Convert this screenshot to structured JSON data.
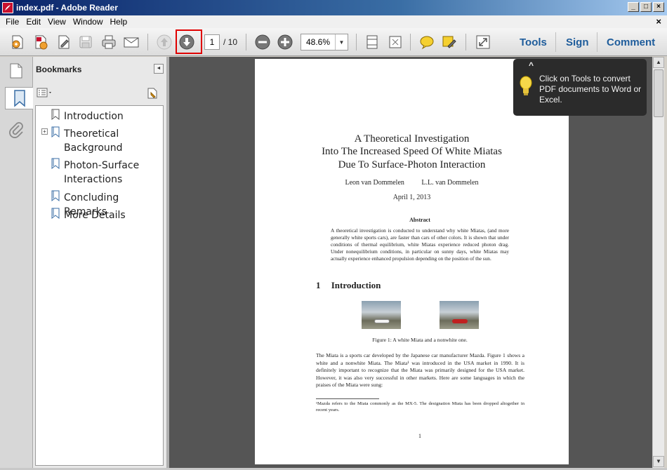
{
  "window": {
    "title": "index.pdf - Adobe Reader",
    "controls": [
      "_",
      "□",
      "×"
    ]
  },
  "menubar": {
    "items": [
      "File",
      "Edit",
      "View",
      "Window",
      "Help"
    ],
    "close": "×"
  },
  "toolbar": {
    "icons": [
      "create-pdf-icon",
      "export-pdf-icon",
      "edit-icon",
      "save-icon",
      "print-icon",
      "email-icon",
      "previous-page-icon",
      "next-page-icon",
      "zoom-out-icon",
      "zoom-in-icon",
      "fit-page-icon",
      "full-screen-icon",
      "comment-icon",
      "sign-icon",
      "read-mode-icon"
    ],
    "page_current": "1",
    "page_total": "/ 10",
    "zoom": "48.6%",
    "tools_label": "Tools",
    "sign_label": "Sign",
    "comment_label": "Comment"
  },
  "bookmarks": {
    "title": "Bookmarks",
    "items": [
      {
        "label": "Introduction"
      },
      {
        "label": "Theoretical\nBackground",
        "line1": "Theoretical",
        "line2": "Background",
        "expandable": true
      },
      {
        "label": "Photon-Surface\nInteractions",
        "line1": "Photon-Surface",
        "line2": "Interactions"
      },
      {
        "label": "Concluding Remarks"
      },
      {
        "label": "More Details"
      }
    ]
  },
  "tooltip": {
    "text": "Click on Tools to convert PDF documents to Word or Excel."
  },
  "document": {
    "title_lines": [
      "A Theoretical Investigation",
      "Into The Increased Speed Of White Miatas",
      "Due To Surface-Photon Interaction"
    ],
    "authors": [
      "Leon van Dommelen",
      "L.L. van Dommelen"
    ],
    "date": "April 1, 2013",
    "abstract_heading": "Abstract",
    "abstract": "A theoretical investigation is conducted to understand why white Miatas, (and more generally white sports cars), are faster than cars of other colors. It is shown that under conditions of thermal equilibrium, white Miatas experience reduced photon drag. Under nonequilibrium conditions, in particular on sunny days, white Miatas may actually experience enhanced propulsion depending on the position of the sun.",
    "section_number": "1",
    "section_title": "Introduction",
    "figure_caption": "Figure 1: A white Miata and a nonwhite one.",
    "body": "The Miata is a sports car developed by the Japanese car manufacturer Mazda. Figure 1 shows a white and a nonwhite Miata. The Miata¹ was introduced in the USA market in 1990. It is definitely important to recognize that the Miata was primarily designed for the USA market. However, it was also very successful in other markets. Here are some languages in which the praises of the Miata were sung:",
    "footnote": "¹Mazda refers to the Miata commonly as the MX-5. The designation Miata has been dropped altogether in recent years.",
    "page_number": "1"
  }
}
